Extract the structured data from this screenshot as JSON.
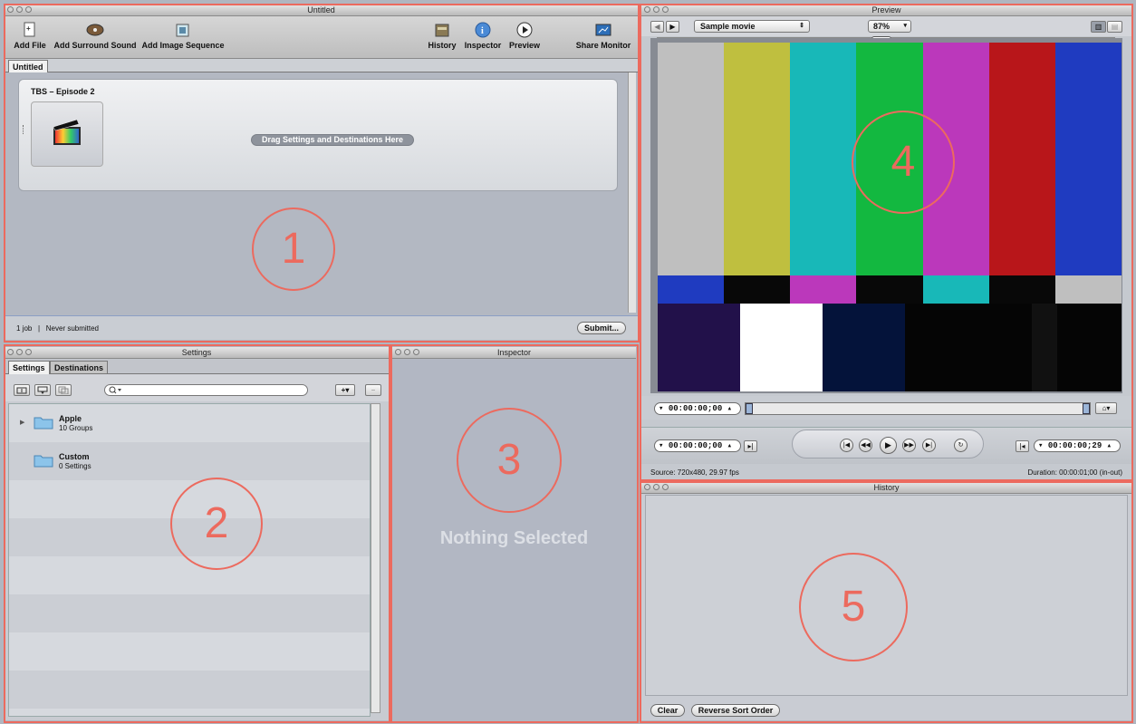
{
  "batch_window": {
    "title": "Untitled",
    "toolbar": {
      "add_file": "Add File",
      "add_surround": "Add Surround Sound",
      "add_image_sequence": "Add Image Sequence",
      "history": "History",
      "inspector": "Inspector",
      "preview": "Preview",
      "share_monitor": "Share Monitor"
    },
    "tab": "Untitled",
    "job_title": "TBS – Episode 2",
    "drop_hint": "Drag Settings and Destinations Here",
    "status": "1 job   |   Never submitted",
    "submit": "Submit..."
  },
  "settings_window": {
    "title": "Settings",
    "tabs": [
      "Settings",
      "Destinations"
    ],
    "groups": [
      {
        "name": "Apple",
        "detail": "10 Groups"
      },
      {
        "name": "Custom",
        "detail": "0 Settings"
      }
    ]
  },
  "inspector_window": {
    "title": "Inspector",
    "empty": "Nothing Selected"
  },
  "preview_window": {
    "title": "Preview",
    "source_select": "Sample movie",
    "zoom": "87%",
    "in_tc": "00:00:00;00",
    "current_tc": "00:00:00;00",
    "out_tc": "00:00:00;29",
    "source_info": "Source: 720x480, 29.97 fps",
    "duration": "Duration: 00:00:01;00 (in-out)",
    "bars_top": [
      "#bfbfbf",
      "#bfbf3f",
      "#18b8b8",
      "#13b840",
      "#bb38bb",
      "#b8161a",
      "#1f3bc0"
    ],
    "bars_mid": [
      "#1f3bc0",
      "#080808",
      "#bb38bb",
      "#080808",
      "#18b8b8",
      "#080808",
      "#bfbfbf"
    ],
    "bars_bottom": [
      "#22114a",
      "#ffffff",
      "#04133a",
      "#050505",
      "#050505",
      "#111111",
      "#050505"
    ]
  },
  "history_window": {
    "title": "History",
    "clear": "Clear",
    "reverse": "Reverse Sort Order"
  },
  "annotations": [
    "1",
    "2",
    "3",
    "4",
    "5"
  ],
  "colors": {
    "annotation": "#ec6a5e",
    "title_gradient_top": "#e6e6e6"
  }
}
